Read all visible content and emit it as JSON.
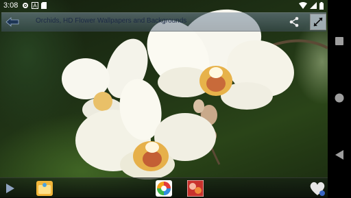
{
  "status_bar": {
    "time": "3:08",
    "left_icons": [
      "settings-icon",
      "notification-a-icon",
      "sd-card-icon"
    ],
    "right_icons": [
      "wifi-icon",
      "signal-icon",
      "battery-icon"
    ]
  },
  "action_bar": {
    "title": "Orchids, HD Flower Wallpapers and Backgrounds",
    "back_icon": "back-arrow-icon",
    "share_icon": "share-icon",
    "expand_icon": "expand-icon"
  },
  "bottom_bar": {
    "items": [
      "play-icon",
      "folder-app-icon",
      "color-wheel-icon",
      "flowers-app-icon",
      "heart-icon"
    ]
  },
  "nav_bar": {
    "items": [
      "recents-square-icon",
      "home-circle-icon",
      "back-triangle-icon"
    ]
  },
  "colors": {
    "title_text": "#1c2a44",
    "nav_icon": "#9e9e9e",
    "petal": "#fbfaf0",
    "lip": "#e7b24a"
  }
}
